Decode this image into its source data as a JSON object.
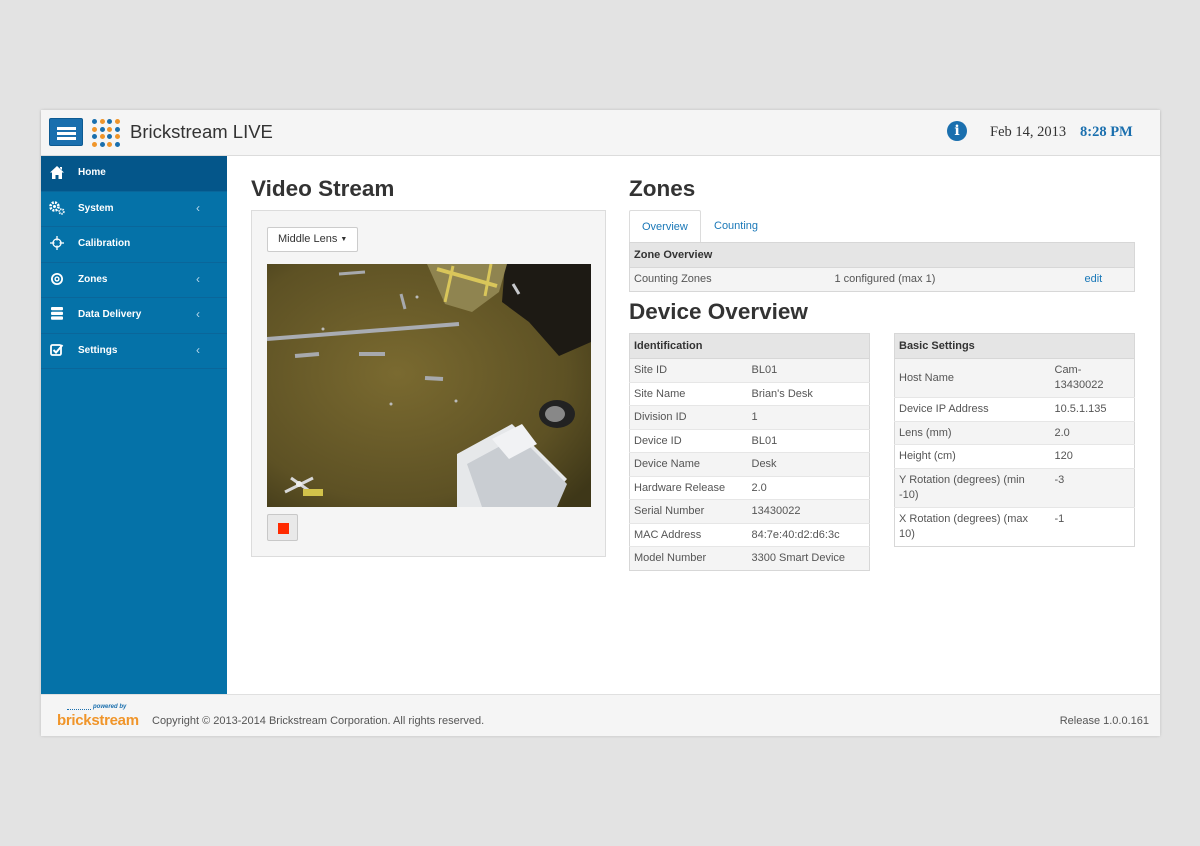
{
  "header": {
    "app_title": "Brickstream LIVE",
    "date": "Feb 14, 2013",
    "time": "8:28 PM",
    "info_icon_glyph": "i",
    "logo_colors": [
      "#1a6fae",
      "#f0952a"
    ]
  },
  "sidebar": {
    "items": [
      {
        "label": "Home",
        "icon": "home-icon",
        "active": true
      },
      {
        "label": "System",
        "icon": "cogs-icon",
        "has_submenu": true
      },
      {
        "label": "Calibration",
        "icon": "crosshair-icon"
      },
      {
        "label": "Zones",
        "icon": "target-icon",
        "has_submenu": true
      },
      {
        "label": "Data Delivery",
        "icon": "database-icon",
        "has_submenu": true
      },
      {
        "label": "Settings",
        "icon": "checkbox-icon",
        "has_submenu": true
      }
    ]
  },
  "video": {
    "title": "Video Stream",
    "lens_select": "Middle Lens"
  },
  "zones": {
    "title": "Zones",
    "tabs": [
      {
        "label": "Overview",
        "active": true
      },
      {
        "label": "Counting",
        "active": false
      }
    ],
    "table_header": "Zone Overview",
    "row": {
      "label": "Counting Zones",
      "value": "1 configured (max 1)",
      "action": "edit"
    }
  },
  "device": {
    "title": "Device Overview",
    "identification": {
      "header": "Identification",
      "rows": [
        {
          "label": "Site ID",
          "value": "BL01"
        },
        {
          "label": "Site Name",
          "value": "Brian's Desk"
        },
        {
          "label": "Division ID",
          "value": "1"
        },
        {
          "label": "Device ID",
          "value": "BL01"
        },
        {
          "label": "Device Name",
          "value": "Desk"
        },
        {
          "label": "Hardware Release",
          "value": "2.0"
        },
        {
          "label": "Serial Number",
          "value": "13430022"
        },
        {
          "label": "MAC Address",
          "value": "84:7e:40:d2:d6:3c"
        },
        {
          "label": "Model Number",
          "value": "3300 Smart Device"
        }
      ]
    },
    "basic_settings": {
      "header": "Basic Settings",
      "rows": [
        {
          "label": "Host Name",
          "value": "Cam-13430022"
        },
        {
          "label": "Device IP Address",
          "value": "10.5.1.135"
        },
        {
          "label": "Lens (mm)",
          "value": "2.0"
        },
        {
          "label": "Height (cm)",
          "value": "120"
        },
        {
          "label": "Y Rotation (degrees) (min -10)",
          "value": "-3"
        },
        {
          "label": "X Rotation (degrees) (max 10)",
          "value": "-1"
        }
      ]
    }
  },
  "footer": {
    "powered_by": "powered by",
    "brand": "brickstream",
    "copyright": "Copyright © 2013-2014 Brickstream Corporation. All rights reserved.",
    "release": "Release 1.0.0.161"
  }
}
